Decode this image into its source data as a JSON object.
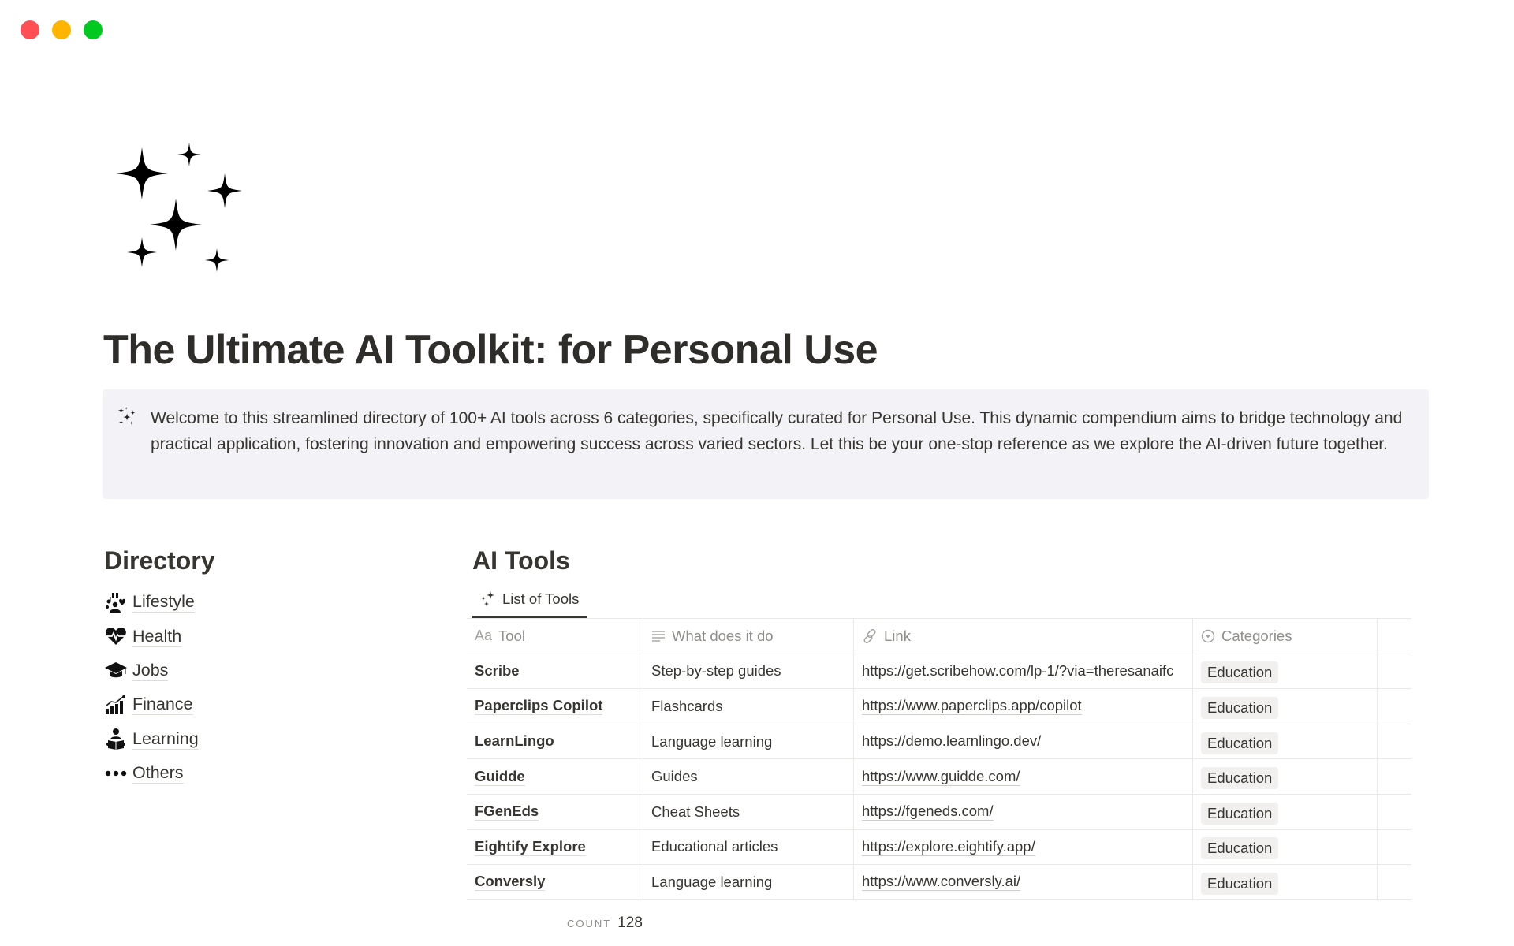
{
  "window": {
    "controls": [
      "close",
      "minimize",
      "maximize"
    ],
    "colors": {
      "close": "#ff4f55",
      "minimize": "#ffb400",
      "maximize": "#00c91f"
    }
  },
  "page": {
    "icon": "sparkles-icon",
    "title": "The Ultimate AI Toolkit: for Personal Use"
  },
  "callout": {
    "icon": "sparkles-icon",
    "text": "Welcome to this streamlined directory of 100+ AI tools across 6 categories, specifically curated for Personal Use. This dynamic compendium aims to bridge technology and practical application, fostering innovation and empowering success across varied sectors. Let this be your one-stop reference as we explore the AI-driven future together."
  },
  "directory": {
    "heading": "Directory",
    "items": [
      {
        "label": "Lifestyle",
        "icon": "lifestyle-icon"
      },
      {
        "label": "Health",
        "icon": "heart-pulse-icon"
      },
      {
        "label": "Jobs",
        "icon": "graduation-cap-icon"
      },
      {
        "label": "Finance",
        "icon": "chart-growth-icon"
      },
      {
        "label": "Learning",
        "icon": "reader-icon"
      },
      {
        "label": "Others",
        "icon": "more-dots-icon"
      }
    ]
  },
  "ai_tools": {
    "heading": "AI Tools",
    "view_tab": {
      "label": "List of Tools",
      "icon": "sparkles-icon"
    },
    "columns": [
      {
        "label": "Tool",
        "icon": "title-aa-icon",
        "icon_text": "Aa"
      },
      {
        "label": "What does it do",
        "icon": "text-lines-icon"
      },
      {
        "label": "Link",
        "icon": "link-icon"
      },
      {
        "label": "Categories",
        "icon": "select-icon"
      }
    ],
    "rows": [
      {
        "tool": "Scribe",
        "what": "Step-by-step guides",
        "link": "https://get.scribehow.com/lp-1/?via=theresanaifc",
        "category": "Education"
      },
      {
        "tool": "Paperclips Copilot",
        "what": "Flashcards",
        "link": "https://www.paperclips.app/copilot",
        "category": "Education"
      },
      {
        "tool": "LearnLingo",
        "what": "Language learning",
        "link": "https://demo.learnlingo.dev/",
        "category": "Education"
      },
      {
        "tool": "Guidde",
        "what": "Guides",
        "link": "https://www.guidde.com/",
        "category": "Education"
      },
      {
        "tool": "FGenEds",
        "what": "Cheat Sheets",
        "link": "https://fgeneds.com/",
        "category": "Education"
      },
      {
        "tool": "Eightify Explore",
        "what": "Educational articles",
        "link": "https://explore.eightify.app/",
        "category": "Education"
      },
      {
        "tool": "Conversly",
        "what": "Language learning",
        "link": "https://www.conversly.ai/",
        "category": "Education"
      }
    ],
    "count_label": "COUNT",
    "count_value": "128"
  }
}
